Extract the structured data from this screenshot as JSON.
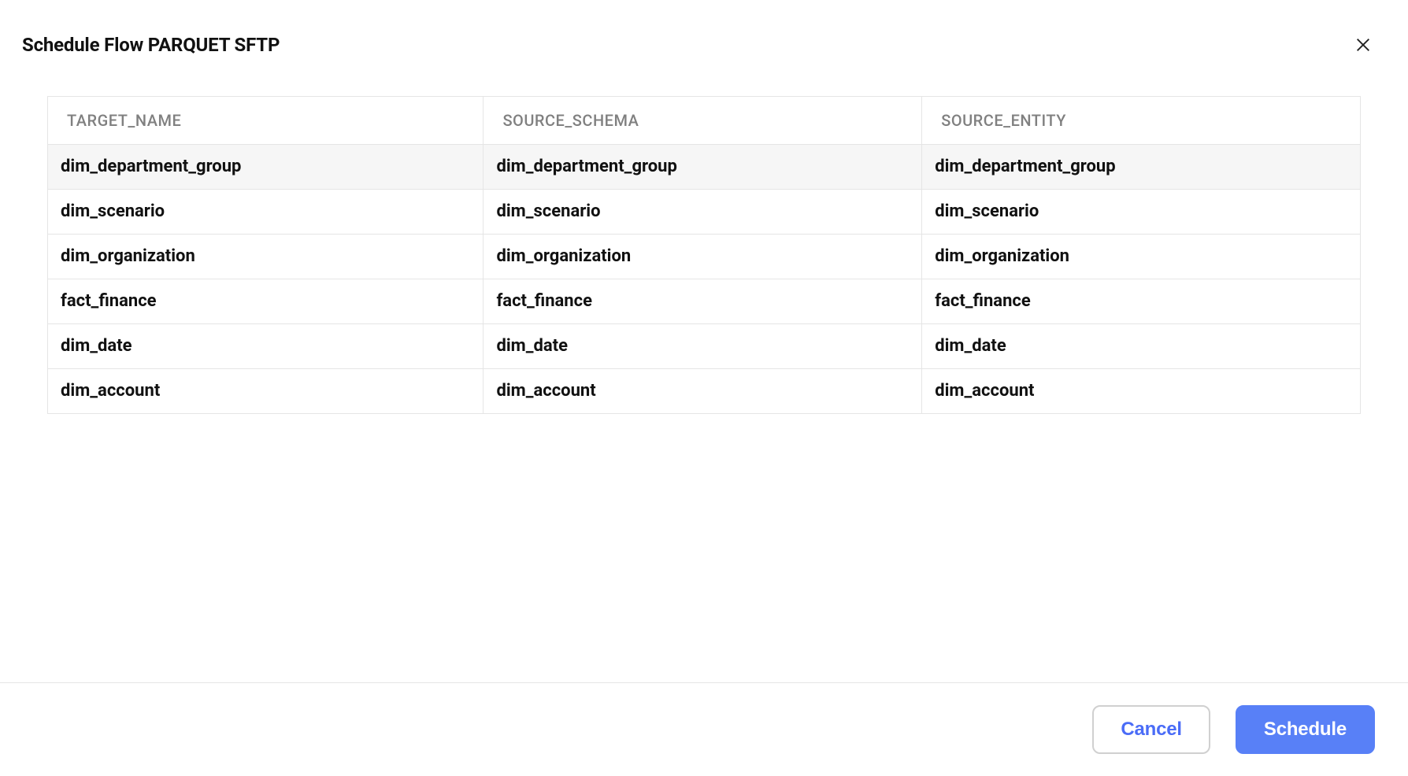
{
  "dialog": {
    "title": "Schedule Flow PARQUET SFTP"
  },
  "table": {
    "columns": [
      "TARGET_NAME",
      "SOURCE_SCHEMA",
      "SOURCE_ENTITY"
    ],
    "rows": [
      {
        "target_name": "dim_department_group",
        "source_schema": "dim_department_group",
        "source_entity": "dim_department_group",
        "selected": true
      },
      {
        "target_name": "dim_scenario",
        "source_schema": "dim_scenario",
        "source_entity": "dim_scenario",
        "selected": false
      },
      {
        "target_name": "dim_organization",
        "source_schema": "dim_organization",
        "source_entity": "dim_organization",
        "selected": false
      },
      {
        "target_name": "fact_finance",
        "source_schema": "fact_finance",
        "source_entity": "fact_finance",
        "selected": false
      },
      {
        "target_name": "dim_date",
        "source_schema": "dim_date",
        "source_entity": "dim_date",
        "selected": false
      },
      {
        "target_name": "dim_account",
        "source_schema": "dim_account",
        "source_entity": "dim_account",
        "selected": false
      }
    ]
  },
  "footer": {
    "cancel_label": "Cancel",
    "schedule_label": "Schedule"
  }
}
